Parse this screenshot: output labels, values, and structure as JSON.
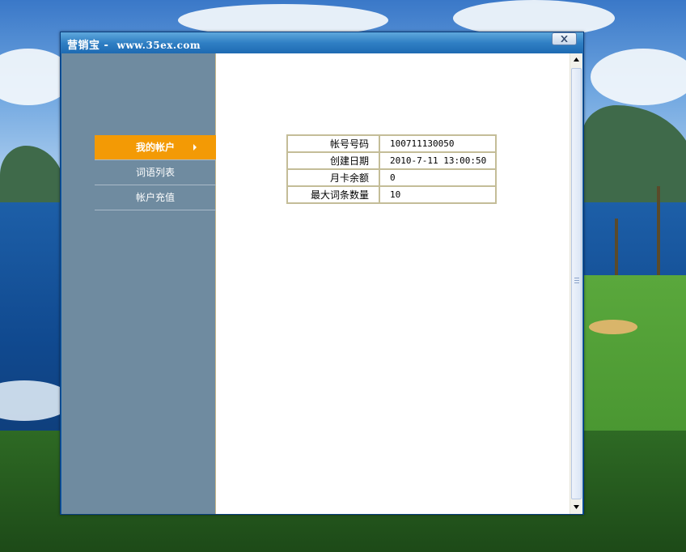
{
  "window": {
    "title_app": "营销宝 - ",
    "title_url": "www.35ex.com"
  },
  "sidebar": {
    "items": [
      {
        "label": "我的帐户",
        "active": true
      },
      {
        "label": "词语列表",
        "active": false
      },
      {
        "label": "帐户充值",
        "active": false
      }
    ]
  },
  "account": {
    "rows": [
      {
        "label": "帐号号码",
        "value": "100711130050"
      },
      {
        "label": "创建日期",
        "value": "2010-7-11 13:00:50"
      },
      {
        "label": "月卡余额",
        "value": "0"
      },
      {
        "label": "最大词条数量",
        "value": "10"
      }
    ]
  },
  "colors": {
    "active_nav": "#f39a05",
    "sidebar_bg": "#6f8ba0",
    "titlebar": "#2f7fc4"
  },
  "icons": {
    "close": "close-icon",
    "nav_arrow": "arrow-right-icon",
    "scroll_up": "scroll-up-icon",
    "scroll_down": "scroll-down-icon"
  }
}
